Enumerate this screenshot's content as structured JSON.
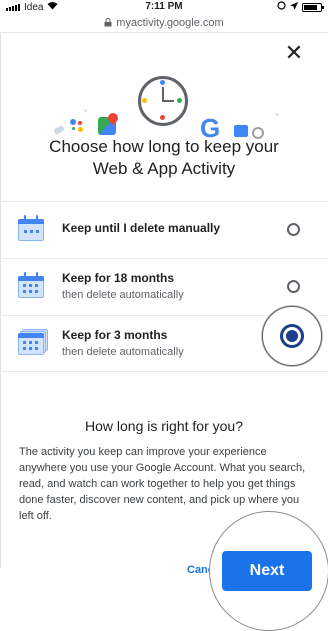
{
  "status_bar": {
    "carrier": "Idea",
    "time": "7:11 PM"
  },
  "browser": {
    "url": "myactivity.google.com"
  },
  "dialog": {
    "close_symbol": "✕",
    "logo_letter": "G",
    "title": "Choose how long to keep your Web & App Activity",
    "options": [
      {
        "label": "Keep until I delete manually",
        "sub": "",
        "selected": false
      },
      {
        "label": "Keep for 18 months",
        "sub": "then delete automatically",
        "selected": false
      },
      {
        "label": "Keep for 3 months",
        "sub": "then delete automatically",
        "selected": true
      }
    ],
    "subtitle": "How long is right for you?",
    "paragraph": "The activity you keep can improve your experience anywhere you use your Google Account. What you search, read, and watch can work together to help you get things done faster, discover new content, and pick up where you left off.",
    "cancel_label": "Cance",
    "next_label": "Next"
  },
  "colors": {
    "accent": "#1a73e8",
    "selected_radio": "#1a3f8b"
  },
  "icons": [
    "wifi-icon",
    "lock-icon",
    "location-icon",
    "battery-icon",
    "close-icon",
    "clock-icon",
    "google-maps-icon",
    "google-logo",
    "calendar-icon"
  ]
}
